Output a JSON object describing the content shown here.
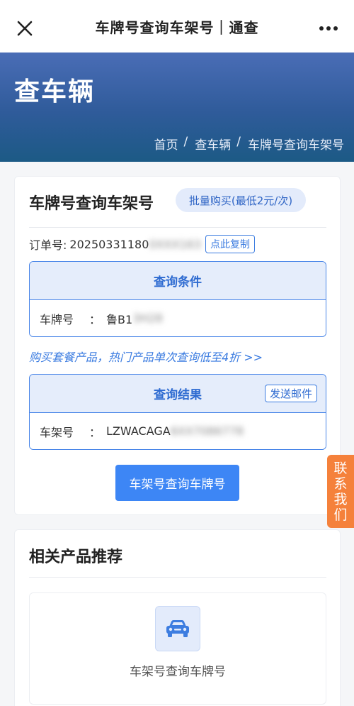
{
  "appbar": {
    "title": "车牌号查询车架号｜通查",
    "close_icon": "close-icon",
    "more_icon": "more-icon"
  },
  "hero": {
    "heading": "查车辆",
    "breadcrumb": {
      "home": "首页",
      "section": "查车辆",
      "current": "车牌号查询车架号"
    }
  },
  "query_card": {
    "title": "车牌号查询车架号",
    "batch_button": "批量购买(最低2元/次)",
    "order_label": "订单号:",
    "order_number_visible": "20250331180",
    "copy_button": "点此复制",
    "conditions_header": "查询条件",
    "plate_label": "车牌号",
    "plate_colon": "：",
    "plate_value_visible": "鲁B1",
    "promo_text": "购买套餐产品，热门产品单次查询低至4折 >>",
    "results_header": "查询结果",
    "send_email_button": "发送邮件",
    "vin_label": "车架号",
    "vin_colon": "：",
    "vin_value_visible": "LZWACAGA",
    "primary_button": "车架号查询车牌号"
  },
  "float_contact": {
    "label": "联系我们"
  },
  "related_card": {
    "title": "相关产品推荐",
    "product_name": "车架号查询车牌号",
    "product_icon": "car-icon"
  },
  "colors": {
    "accent": "#3d86f5",
    "hero_top": "#4a6db6",
    "hero_bottom": "#1c5a85",
    "contact": "#f5813b"
  }
}
